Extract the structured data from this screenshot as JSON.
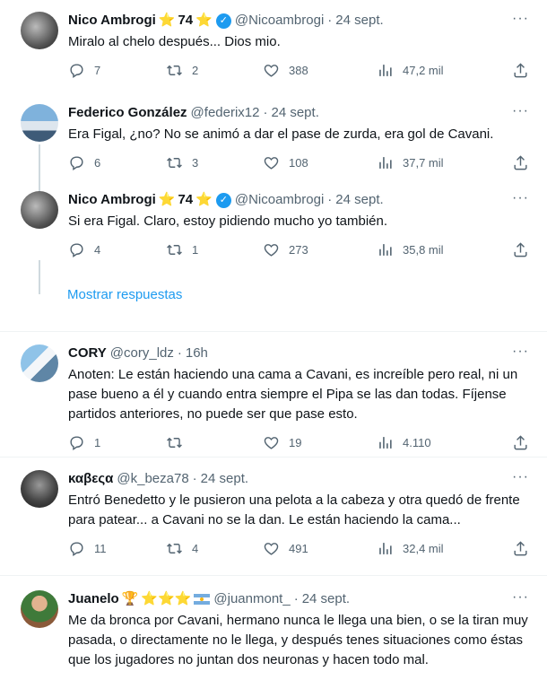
{
  "tweets": [
    {
      "name": "Nico Ambrogi",
      "star_a": "⭐",
      "num": "74",
      "star_b": "⭐",
      "handle": "@Nicoambrogi",
      "dot": "·",
      "time": "24 sept.",
      "text": "Miralo al chelo después... Dios mio.",
      "replies": "7",
      "retweets": "2",
      "likes": "388",
      "views": "47,2 mil"
    },
    {
      "name": "Federico González",
      "handle": "@federix12",
      "dot": "·",
      "time": "24 sept.",
      "text": "Era Figal, ¿no? No se animó a dar el pase de zurda, era gol de Cavani.",
      "replies": "6",
      "retweets": "3",
      "likes": "108",
      "views": "37,7 mil"
    },
    {
      "name": "Nico Ambrogi",
      "star_a": "⭐",
      "num": "74",
      "star_b": "⭐",
      "handle": "@Nicoambrogi",
      "dot": "·",
      "time": "24 sept.",
      "text": "Si era Figal. Claro, estoy pidiendo mucho yo también.",
      "replies": "4",
      "retweets": "1",
      "likes": "273",
      "views": "35,8 mil"
    },
    {
      "name": "CORY",
      "handle": "@cory_ldz",
      "dot": "·",
      "time": "16h",
      "text": "Anoten: Le están haciendo una cama a Cavani, es increíble pero real, ni un pase bueno a él y cuando entra siempre el Pipa se las dan todas. Fíjense partidos anteriores, no puede ser que pase esto.",
      "replies": "1",
      "retweets": "",
      "likes": "19",
      "views": "4.110"
    },
    {
      "name": "καβεςα",
      "handle": "@k_beza78",
      "dot": "·",
      "time": "24 sept.",
      "text": "Entró Benedetto y le pusieron una pelota a la cabeza y otra quedó de frente para patear... a Cavani no se la dan. Le están haciendo la cama...",
      "replies": "11",
      "retweets": "4",
      "likes": "491",
      "views": "32,4 mil"
    },
    {
      "name": "Juanelo",
      "trophy": "🏆",
      "stars": "⭐⭐⭐",
      "handle": "@juanmont_",
      "dot": "·",
      "time": "24 sept.",
      "text": "Me da bronca por Cavani, hermano nunca le llega una bien, o se la tiran muy pasada, o directamente no le llega, y después tenes situaciones como éstas que los jugadores no juntan dos neuronas y hacen todo mal."
    }
  ],
  "show_replies": "Mostrar respuestas",
  "more_glyph": "···",
  "colors": {
    "link": "#1d9bf0",
    "muted": "#536471",
    "verified": "#1d9bf0"
  },
  "icons": [
    "reply-icon",
    "retweet-icon",
    "like-icon",
    "views-icon",
    "share-icon",
    "more-icon",
    "verified-icon"
  ]
}
